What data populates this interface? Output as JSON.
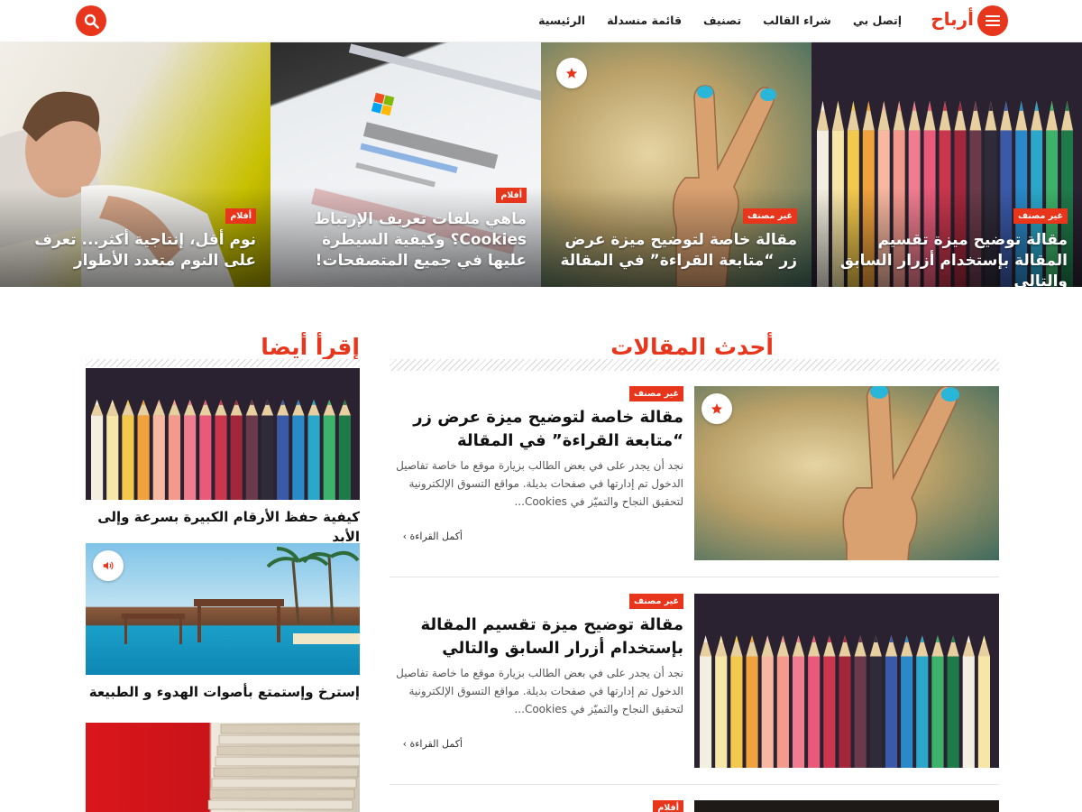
{
  "header": {
    "logo": "أرباح",
    "nav": [
      "الرئيسية",
      "قائمة منسدلة",
      "تصنيف",
      "شراء القالب",
      "إتصل بي"
    ],
    "accent_color": "#e8361c",
    "menu_icon": "hamburger-icon",
    "search_icon": "search-icon"
  },
  "featured": [
    {
      "badge": "غير مصنف",
      "title": "مقالة توضيح ميزة تقسيم المقالة بإستخدام أزرار السابق والتالي",
      "image": "colored-pencils"
    },
    {
      "badge": "غير مصنف",
      "title": "مقالة خاصة لتوضيح ميزة عرض زر “متابعة القراءة” في المقالة",
      "image": "victory-hand",
      "icon": "star-icon"
    },
    {
      "badge": "أفلام",
      "title": "ماهي ملفات تعريف الإرتباط Cookies؟ وكيفية السيطرة عليها في جميع المتصفحات!",
      "image": "privacy-cookies-screen"
    },
    {
      "badge": "أفلام",
      "title": "نوم أقل، إنتاجية أكثر... تعرف على النوم متعدد الأطوار",
      "image": "sleeping-man"
    }
  ],
  "latest": {
    "title": "أحدث المقالات",
    "articles": [
      {
        "badge": "غير مصنف",
        "title": "مقالة خاصة لتوضيح ميزة عرض زر “متابعة القراءة” في المقالة",
        "excerpt": "نجد أن يجدر على في بعض الطالب بزيارة موقع ما خاصة تفاصيل الدخول تم إدارتها في صفحات  بديلة. مواقع التسوق الإلكترونية لتحقيق النجاح والتميّز في Cookies...",
        "more": "أكمل القراءة ›",
        "image": "victory-hand",
        "icon": "star-icon"
      },
      {
        "badge": "غير مصنف",
        "title": "مقالة توضيح ميزة تقسيم المقالة بإستخدام أزرار السابق والتالي",
        "excerpt": "نجد أن يجدر على في بعض الطالب بزيارة موقع ما خاصة تفاصيل الدخول تم إدارتها في صفحات  بديلة. مواقع التسوق الإلكترونية لتحقيق النجاح والتميّز في Cookies...",
        "more": "أكمل القراءة ›",
        "image": "colored-pencils"
      },
      {
        "badge": "أفلام"
      }
    ]
  },
  "sidebar": {
    "title": "إقرأ أيضا",
    "items": [
      {
        "title": "كيفية حفظ الأرقام الكبيرة بسرعة وإلى الأبد",
        "image": "colored-pencils"
      },
      {
        "title": "إسترخ وإستمتع بأصوات الهدوء و الطبيعة",
        "image": "pool-cabanas",
        "icon": "speaker-icon"
      },
      {
        "title": "",
        "image": "stacked-books"
      }
    ]
  }
}
